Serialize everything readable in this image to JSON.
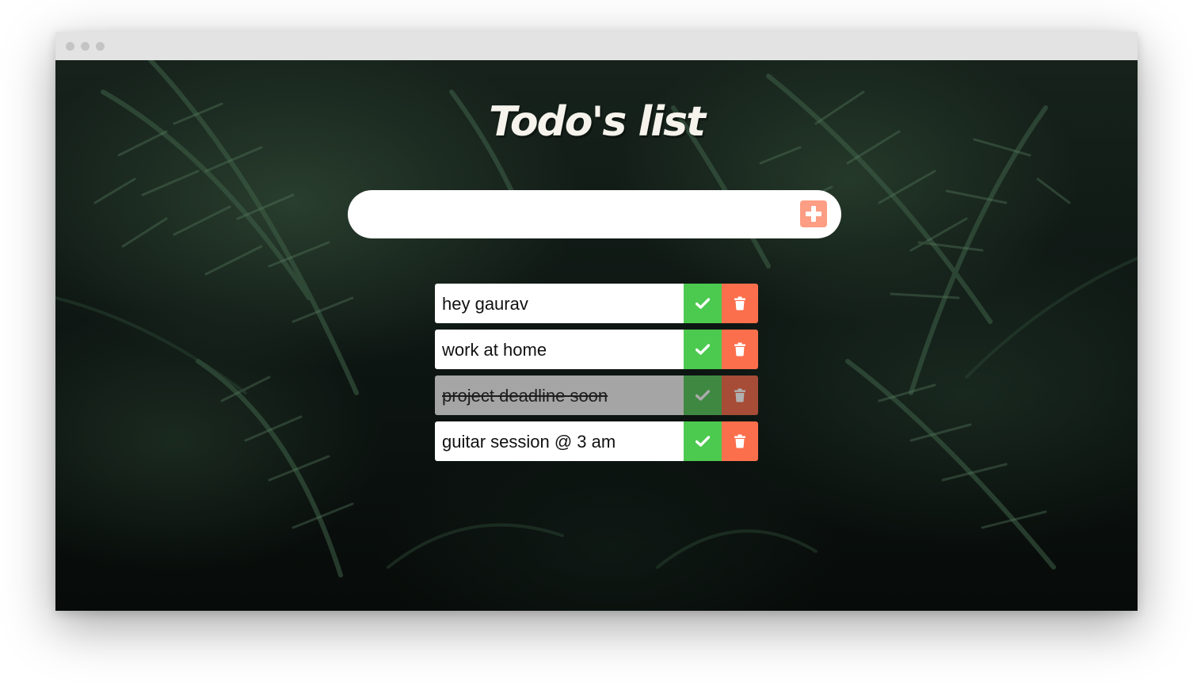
{
  "app": {
    "title": "Todo's list"
  },
  "add_form": {
    "input_value": "",
    "input_placeholder": "",
    "add_icon": "plus-square-icon"
  },
  "todos": [
    {
      "text": "hey gaurav",
      "completed": false
    },
    {
      "text": "work at home",
      "completed": false
    },
    {
      "text": "project deadline soon",
      "completed": true
    },
    {
      "text": "guitar session @ 3 am",
      "completed": false
    }
  ],
  "icons": {
    "complete": "check-icon",
    "delete": "trash-icon"
  },
  "colors": {
    "accent_add": "#fc9d84",
    "complete_green": "#4cc94f",
    "delete_orange": "#fc6f4c",
    "title_text": "#f5f3ec"
  }
}
